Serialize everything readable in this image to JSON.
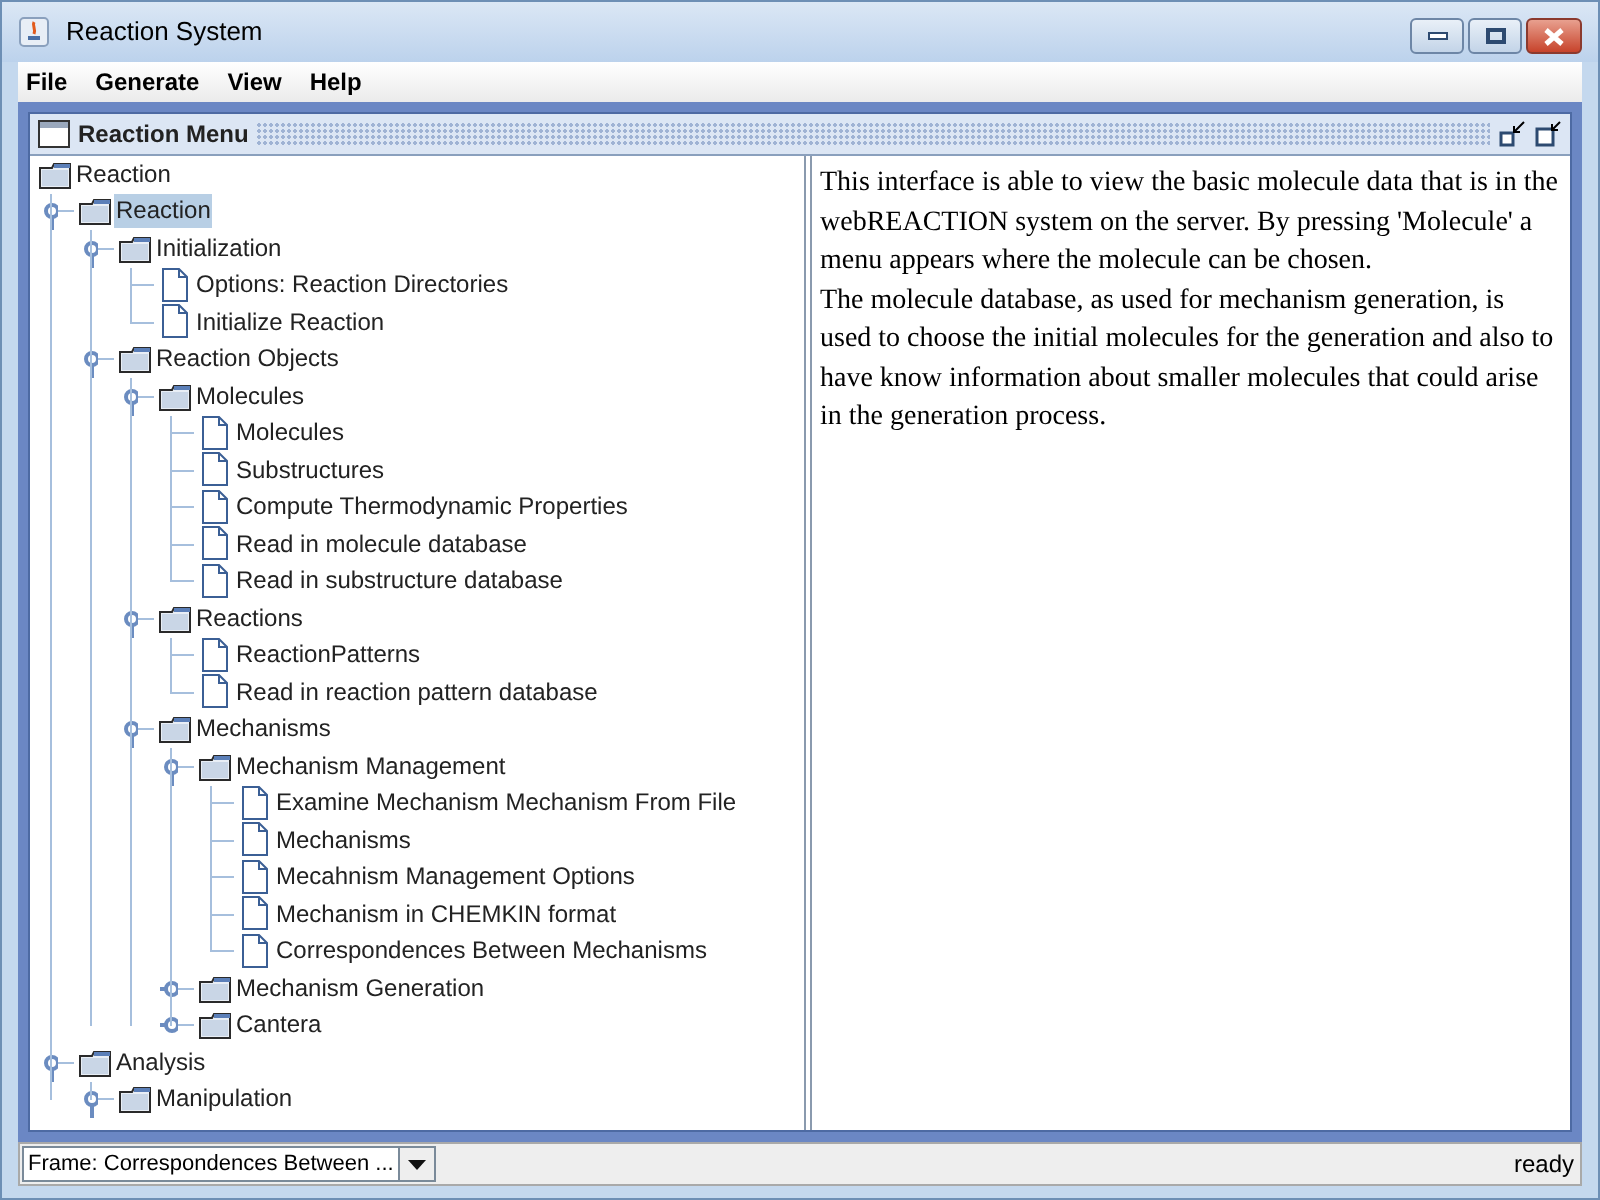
{
  "window": {
    "title": "Reaction System"
  },
  "menu": [
    "File",
    "Generate",
    "View",
    "Help"
  ],
  "internal_frame": {
    "title": "Reaction Menu"
  },
  "tree": {
    "label": "Reaction",
    "kind": "folder",
    "selected": false,
    "children": [
      {
        "label": "Reaction",
        "kind": "folder",
        "expanded": true,
        "selected": true,
        "children": [
          {
            "label": "Initialization",
            "kind": "folder",
            "expanded": true,
            "selected": false,
            "children": [
              {
                "label": "Options: Reaction Directories",
                "kind": "leaf",
                "selected": false
              },
              {
                "label": "Initialize Reaction",
                "kind": "leaf",
                "selected": false
              }
            ]
          },
          {
            "label": "Reaction Objects",
            "kind": "folder",
            "expanded": true,
            "selected": false,
            "children": [
              {
                "label": "Molecules",
                "kind": "folder",
                "expanded": true,
                "selected": false,
                "children": [
                  {
                    "label": "Molecules",
                    "kind": "leaf",
                    "selected": false
                  },
                  {
                    "label": "Substructures",
                    "kind": "leaf",
                    "selected": false
                  },
                  {
                    "label": "Compute Thermodynamic Properties",
                    "kind": "leaf",
                    "selected": false
                  },
                  {
                    "label": "Read in molecule database",
                    "kind": "leaf",
                    "selected": false
                  },
                  {
                    "label": "Read in substructure database",
                    "kind": "leaf",
                    "selected": false
                  }
                ]
              },
              {
                "label": "Reactions",
                "kind": "folder",
                "expanded": true,
                "selected": false,
                "children": [
                  {
                    "label": "ReactionPatterns",
                    "kind": "leaf",
                    "selected": false
                  },
                  {
                    "label": "Read in reaction pattern database",
                    "kind": "leaf",
                    "selected": false
                  }
                ]
              },
              {
                "label": "Mechanisms",
                "kind": "folder",
                "expanded": true,
                "selected": false,
                "children": [
                  {
                    "label": "Mechanism Management",
                    "kind": "folder",
                    "expanded": true,
                    "selected": false,
                    "children": [
                      {
                        "label": "Examine Mechanism Mechanism From File",
                        "kind": "leaf",
                        "selected": false
                      },
                      {
                        "label": "Mechanisms",
                        "kind": "leaf",
                        "selected": false
                      },
                      {
                        "label": "Mecahnism Management Options",
                        "kind": "leaf",
                        "selected": false
                      },
                      {
                        "label": "Mechanism in CHEMKIN format",
                        "kind": "leaf",
                        "selected": false
                      },
                      {
                        "label": "Correspondences Between Mechanisms",
                        "kind": "leaf",
                        "selected": false
                      }
                    ]
                  },
                  {
                    "label": "Mechanism Generation",
                    "kind": "folder",
                    "expanded": false,
                    "selected": false
                  },
                  {
                    "label": "Cantera",
                    "kind": "folder",
                    "expanded": false,
                    "selected": false
                  }
                ]
              }
            ]
          }
        ]
      },
      {
        "label": "Analysis",
        "kind": "folder",
        "expanded": true,
        "selected": false,
        "children": [
          {
            "label": "Manipulation",
            "kind": "folder",
            "expanded": true,
            "selected": false
          }
        ]
      }
    ]
  },
  "description": [
    "This interface is able to view the basic molecule data that is in the webREACTION system on the server. By pressing 'Molecule' a menu appears where the molecule can be chosen.",
    "The molecule database, as used for mechanism generation, is used to choose the initial molecules for the generation and also to have know information about smaller molecules that could arise in the generation process."
  ],
  "status_bar": {
    "frame_select": "Frame: Correspondences Between ...",
    "status": "ready"
  }
}
